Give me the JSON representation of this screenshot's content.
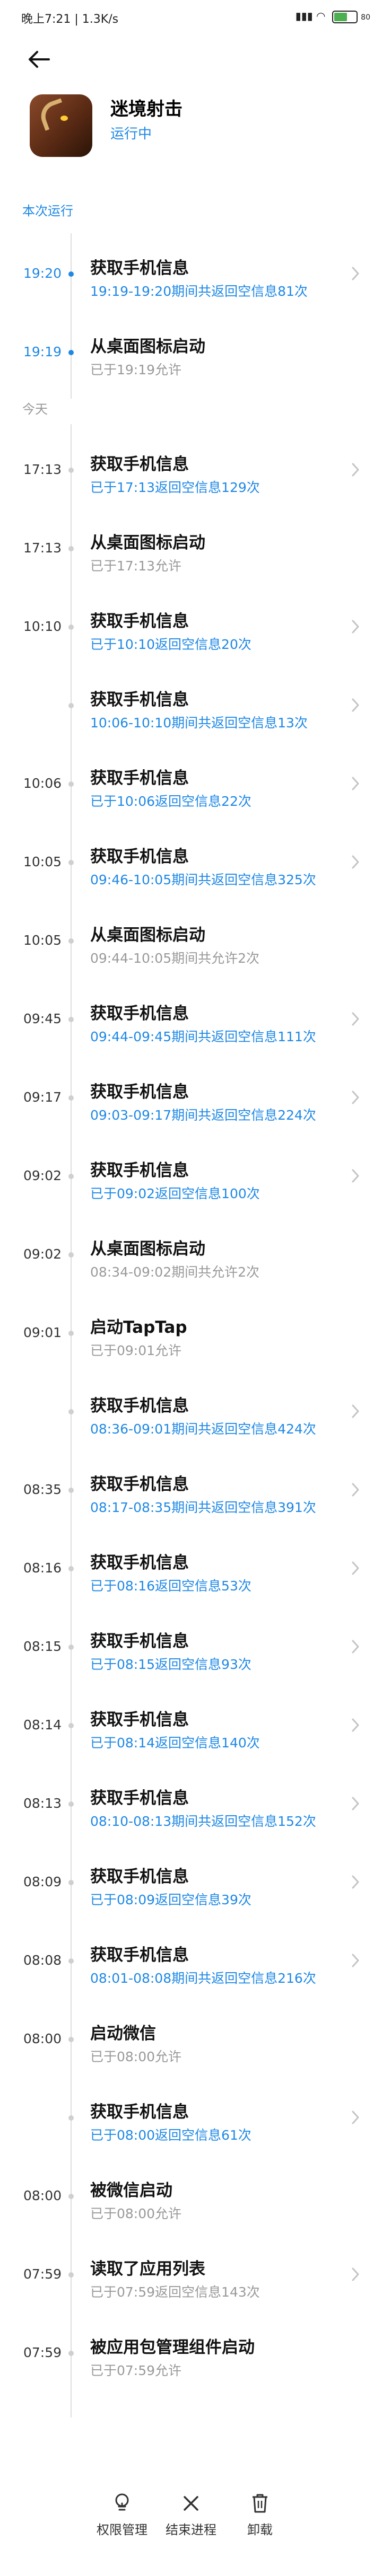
{
  "status_bar": {
    "time_network": "晚上7:21 | 1.3K/s",
    "battery": "80"
  },
  "app": {
    "name": "迷境射击",
    "status": "运行中"
  },
  "sections": {
    "current": "本次运行",
    "today": "今天"
  },
  "current_run": [
    {
      "time": "19:20",
      "title": "获取手机信息",
      "detail": "19:19-19:20期间共返回空信息81次",
      "detail_color": "blue",
      "has_arrow": true
    },
    {
      "time": "19:19",
      "title": "从桌面图标启动",
      "detail": "已于19:19允许",
      "detail_color": "gray",
      "has_arrow": false
    }
  ],
  "today": [
    {
      "time": "17:13",
      "title": "获取手机信息",
      "detail": "已于17:13返回空信息129次",
      "detail_color": "blue",
      "has_arrow": true
    },
    {
      "time": "17:13",
      "title": "从桌面图标启动",
      "detail": "已于17:13允许",
      "detail_color": "gray",
      "has_arrow": false
    },
    {
      "time": "10:10",
      "title": "获取手机信息",
      "detail": "已于10:10返回空信息20次",
      "detail_color": "blue",
      "has_arrow": true
    },
    {
      "time": "",
      "title": "获取手机信息",
      "detail": "10:06-10:10期间共返回空信息13次",
      "detail_color": "blue",
      "has_arrow": true
    },
    {
      "time": "10:06",
      "title": "获取手机信息",
      "detail": "已于10:06返回空信息22次",
      "detail_color": "blue",
      "has_arrow": true
    },
    {
      "time": "10:05",
      "title": "获取手机信息",
      "detail": "09:46-10:05期间共返回空信息325次",
      "detail_color": "blue",
      "has_arrow": true
    },
    {
      "time": "10:05",
      "title": "从桌面图标启动",
      "detail": "09:44-10:05期间共允许2次",
      "detail_color": "gray",
      "has_arrow": false
    },
    {
      "time": "09:45",
      "title": "获取手机信息",
      "detail": "09:44-09:45期间共返回空信息111次",
      "detail_color": "blue",
      "has_arrow": true
    },
    {
      "time": "09:17",
      "title": "获取手机信息",
      "detail": "09:03-09:17期间共返回空信息224次",
      "detail_color": "blue",
      "has_arrow": true
    },
    {
      "time": "09:02",
      "title": "获取手机信息",
      "detail": "已于09:02返回空信息100次",
      "detail_color": "blue",
      "has_arrow": true
    },
    {
      "time": "09:02",
      "title": "从桌面图标启动",
      "detail": "08:34-09:02期间共允许2次",
      "detail_color": "gray",
      "has_arrow": false
    },
    {
      "time": "09:01",
      "title": "启动TapTap",
      "detail": "已于09:01允许",
      "detail_color": "gray",
      "has_arrow": false
    },
    {
      "time": "",
      "title": "获取手机信息",
      "detail": "08:36-09:01期间共返回空信息424次",
      "detail_color": "blue",
      "has_arrow": true
    },
    {
      "time": "08:35",
      "title": "获取手机信息",
      "detail": "08:17-08:35期间共返回空信息391次",
      "detail_color": "blue",
      "has_arrow": true
    },
    {
      "time": "08:16",
      "title": "获取手机信息",
      "detail": "已于08:16返回空信息53次",
      "detail_color": "blue",
      "has_arrow": true
    },
    {
      "time": "08:15",
      "title": "获取手机信息",
      "detail": "已于08:15返回空信息93次",
      "detail_color": "blue",
      "has_arrow": true
    },
    {
      "time": "08:14",
      "title": "获取手机信息",
      "detail": "已于08:14返回空信息140次",
      "detail_color": "blue",
      "has_arrow": true
    },
    {
      "time": "08:13",
      "title": "获取手机信息",
      "detail": "08:10-08:13期间共返回空信息152次",
      "detail_color": "blue",
      "has_arrow": true
    },
    {
      "time": "08:09",
      "title": "获取手机信息",
      "detail": "已于08:09返回空信息39次",
      "detail_color": "blue",
      "has_arrow": true
    },
    {
      "time": "08:08",
      "title": "获取手机信息",
      "detail": "08:01-08:08期间共返回空信息216次",
      "detail_color": "blue",
      "has_arrow": true
    },
    {
      "time": "08:00",
      "title": "启动微信",
      "detail": "已于08:00允许",
      "detail_color": "gray",
      "has_arrow": false
    },
    {
      "time": "",
      "title": "获取手机信息",
      "detail": "已于08:00返回空信息61次",
      "detail_color": "blue",
      "has_arrow": true
    },
    {
      "time": "08:00",
      "title": "被微信启动",
      "detail": "已于08:00允许",
      "detail_color": "gray",
      "has_arrow": false
    },
    {
      "time": "07:59",
      "title": "读取了应用列表",
      "detail": "已于07:59返回空信息143次",
      "detail_color": "gray",
      "has_arrow": true
    },
    {
      "time": "07:59",
      "title": "被应用包管理组件启动",
      "detail": "已于07:59允许",
      "detail_color": "gray",
      "has_arrow": false
    }
  ],
  "bottom_bar": {
    "permissions": "权限管理",
    "end_process": "结束进程",
    "uninstall": "卸载"
  }
}
